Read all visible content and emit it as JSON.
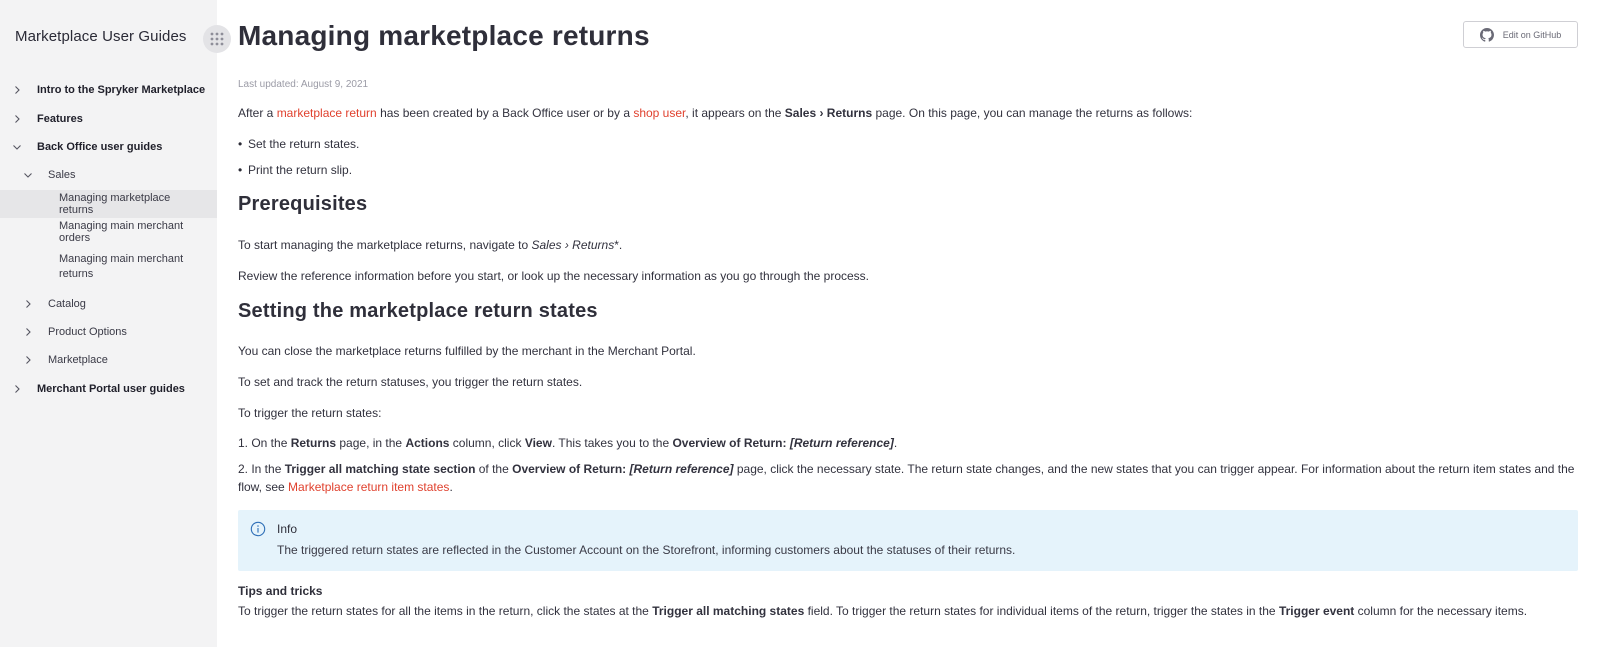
{
  "sidebar": {
    "title": "Marketplace User Guides",
    "apps_icon": "grid-dots-icon",
    "items": [
      {
        "label": "Intro to the Spryker Marketplace",
        "level": 0,
        "bold": true,
        "expanded": false
      },
      {
        "label": "Features",
        "level": 0,
        "bold": true,
        "expanded": false
      },
      {
        "label": "Back Office user guides",
        "level": 0,
        "bold": true,
        "expanded": true
      },
      {
        "label": "Sales",
        "level": 1,
        "bold": false,
        "expanded": true
      },
      {
        "label": "Managing marketplace returns",
        "level": 2,
        "active": true
      },
      {
        "label": "Managing main merchant orders",
        "level": 2
      },
      {
        "label": "Managing main merchant returns",
        "level": 2
      },
      {
        "label": "Catalog",
        "level": 1,
        "expanded": false
      },
      {
        "label": "Product Options",
        "level": 1,
        "expanded": false
      },
      {
        "label": "Marketplace",
        "level": 1,
        "expanded": false
      },
      {
        "label": "Merchant Portal user guides",
        "level": 0,
        "bold": true,
        "expanded": false
      }
    ]
  },
  "header": {
    "title": "Managing marketplace returns",
    "github_button": "Edit on GitHub",
    "github_icon": "github-icon"
  },
  "article": {
    "last_updated": "Last updated: August 9, 2021",
    "intro": {
      "p1": "After a ",
      "link1": "marketplace return",
      "p2": " has been created by a Back Office user or by a ",
      "link2": "shop user",
      "p3": ", it appears on the ",
      "bold1": "Sales › Returns",
      "p4": " page. On this page, you can manage the returns as follows:"
    },
    "bullets": [
      "Set the return states.",
      "Print the return slip."
    ],
    "h_prereq": "Prerequisites",
    "prereq_p1_a": "To start managing the marketplace returns, navigate to ",
    "prereq_p1_em": "Sales › Returns",
    "prereq_p1_b": "*.",
    "prereq_p2": "Review the reference information before you start, or look up the necessary information as you go through the process.",
    "h_setting": "Setting the marketplace return states",
    "set_p1": "You can close the marketplace returns fulfilled by the merchant in the Merchant Portal.",
    "set_p2": "To set and track the return statuses, you trigger the return states.",
    "set_p3": "To trigger the return states:",
    "step1": {
      "a": "1. On the ",
      "b1": "Returns",
      "c": " page, in the ",
      "b2": "Actions",
      "d": " column, click ",
      "b3": "View",
      "e": ". This takes you to the ",
      "b4": "Overview of Return: ",
      "bi": "[Return reference]",
      "f": "."
    },
    "step2": {
      "a": "2. In the ",
      "b1": "Trigger all matching state section",
      "c": " of the ",
      "b2": "Overview of Return: ",
      "bi": "[Return reference]",
      "d": " page, click the necessary state. The return state changes, and the new states that you can trigger appear. For information about the return item states and the flow, see ",
      "link": "Marketplace return item states",
      "e": "."
    },
    "info": {
      "icon": "info-circle-icon",
      "title": "Info",
      "text": "The triggered return states are reflected in the Customer Account on the Storefront, informing customers about the statuses of their returns."
    },
    "tips_title": "Tips and tricks",
    "tips": {
      "a": "To trigger the return states for all the items in the return, click the states at the ",
      "b1": "Trigger all matching states",
      "c": " field. To trigger the return states for individual items of the return, trigger the states in the ",
      "b2": "Trigger event",
      "d": " column for the necessary items."
    }
  },
  "colors": {
    "link": "#e0412e",
    "sidebar_bg": "#f3f3f4",
    "info_bg": "#e5f3fb"
  }
}
